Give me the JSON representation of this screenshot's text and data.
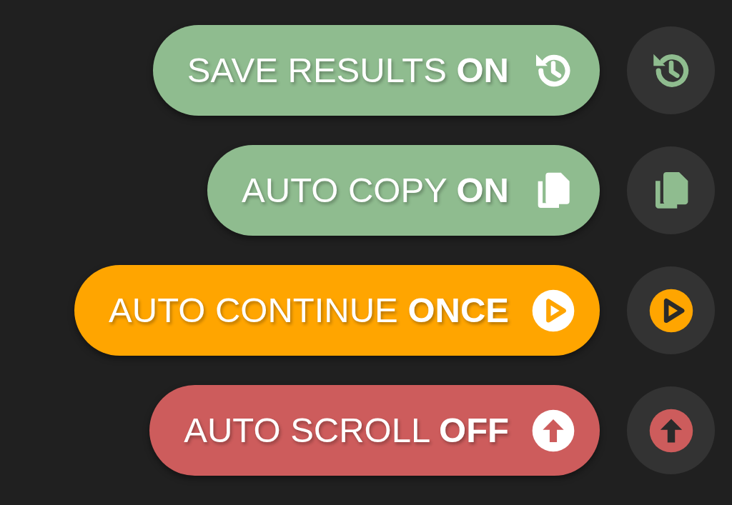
{
  "toggles": [
    {
      "label": "SAVE RESULTS **ON**",
      "kind": "history",
      "color": "#8fbc8f"
    },
    {
      "label": "AUTO COPY **ON**",
      "kind": "copy",
      "color": "#8fbc8f"
    },
    {
      "label": "AUTO CONTINUE **ONCE**",
      "kind": "play",
      "color": "#ffa500"
    },
    {
      "label": "AUTO SCROLL **OFF**",
      "kind": "up",
      "color": "#cd5c5c"
    }
  ]
}
